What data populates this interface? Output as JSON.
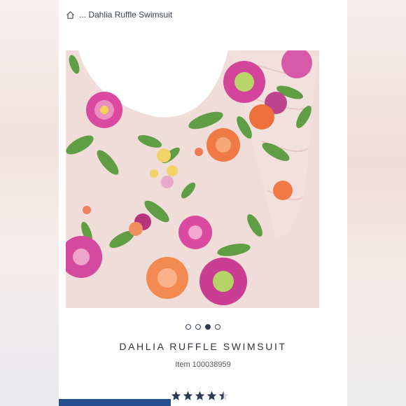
{
  "breadcrumb": {
    "home_icon": "home-icon",
    "text": "... Dahlia Ruffle Swimsuit"
  },
  "product": {
    "title": "DAHLIA RUFFLE SWIMSUIT",
    "item_number": "Item 100038959",
    "image_count": 4,
    "active_image_index": 2,
    "rating": 4.5,
    "rating_max": 5
  },
  "colors": {
    "navy": "#2d3a54",
    "swimsuit_base": "#f0dcd8",
    "bottom_bar": "#234f8f"
  }
}
